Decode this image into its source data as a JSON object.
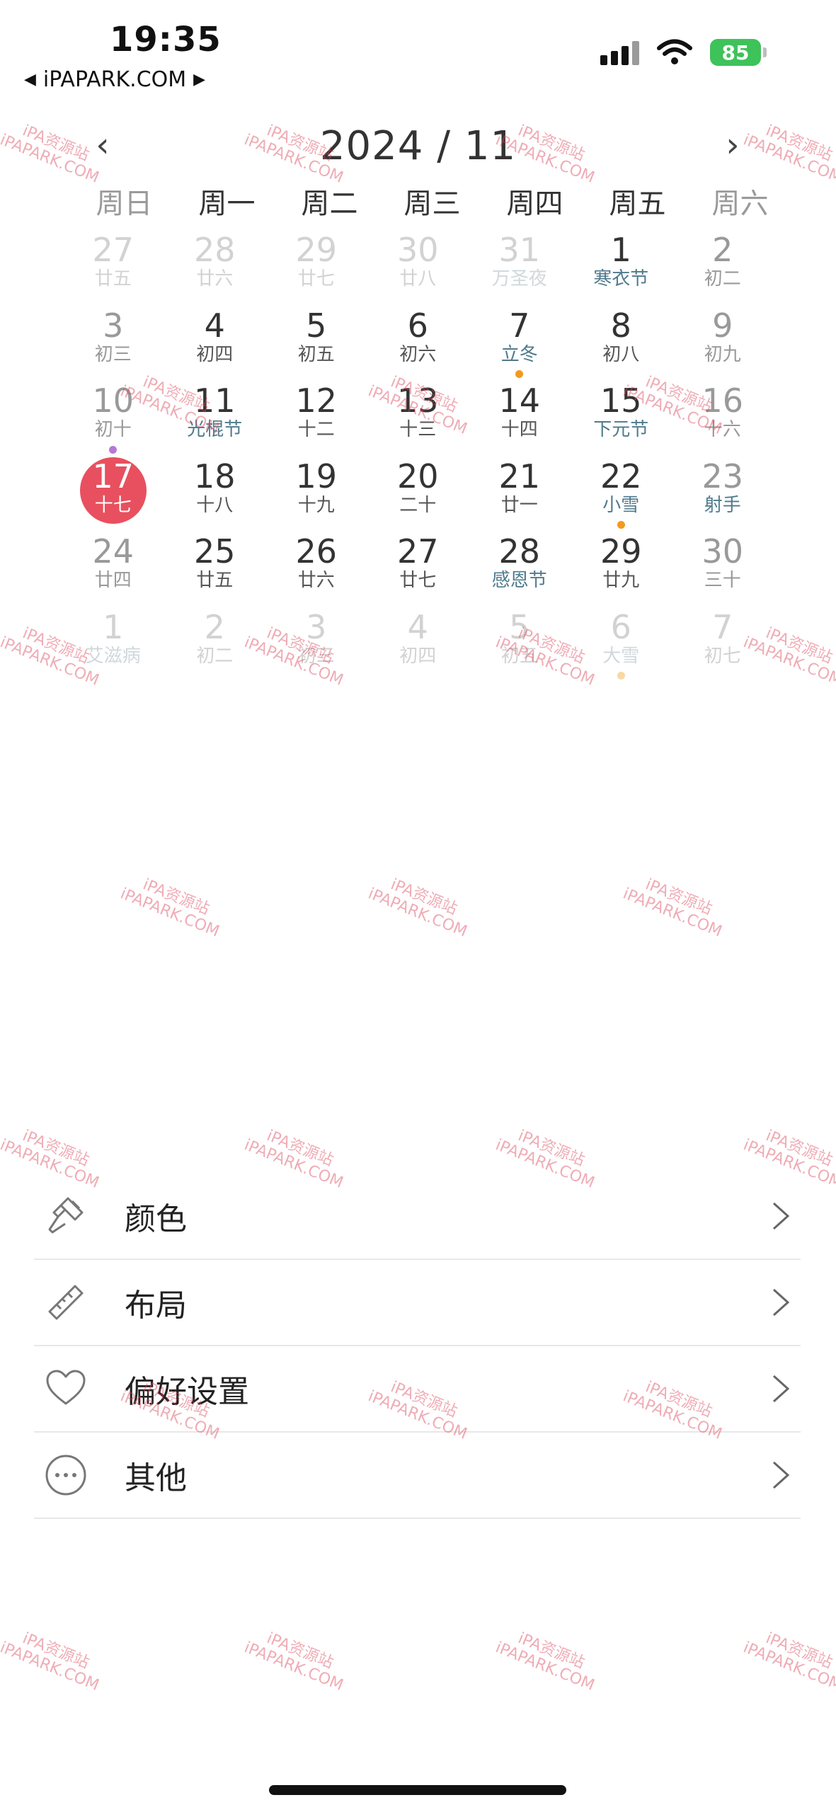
{
  "status_bar": {
    "time": "19:35",
    "back_label": "iPAPARK.COM",
    "battery": "85"
  },
  "calendar": {
    "title": "2024 / 11",
    "prev_label": "‹",
    "next_label": "›",
    "weekdays": [
      "周日",
      "周一",
      "周二",
      "周三",
      "周四",
      "周五",
      "周六"
    ],
    "days": [
      {
        "num": "27",
        "sub": "廿五",
        "state": "muted"
      },
      {
        "num": "28",
        "sub": "廿六",
        "state": "muted"
      },
      {
        "num": "29",
        "sub": "廿七",
        "state": "muted"
      },
      {
        "num": "30",
        "sub": "廿八",
        "state": "muted"
      },
      {
        "num": "31",
        "sub": "万圣夜",
        "state": "muted",
        "festival": true
      },
      {
        "num": "1",
        "sub": "寒衣节",
        "festival": true
      },
      {
        "num": "2",
        "sub": "初二",
        "weekend": true
      },
      {
        "num": "3",
        "sub": "初三",
        "weekend": true
      },
      {
        "num": "4",
        "sub": "初四"
      },
      {
        "num": "5",
        "sub": "初五"
      },
      {
        "num": "6",
        "sub": "初六"
      },
      {
        "num": "7",
        "sub": "立冬",
        "festival": true,
        "dot": "#f29a1d"
      },
      {
        "num": "8",
        "sub": "初八"
      },
      {
        "num": "9",
        "sub": "初九",
        "weekend": true
      },
      {
        "num": "10",
        "sub": "初十",
        "weekend": true,
        "dot": "#b777d6"
      },
      {
        "num": "11",
        "sub": "光棍节",
        "festival": true
      },
      {
        "num": "12",
        "sub": "十二"
      },
      {
        "num": "13",
        "sub": "十三"
      },
      {
        "num": "14",
        "sub": "十四"
      },
      {
        "num": "15",
        "sub": "下元节",
        "festival": true
      },
      {
        "num": "16",
        "sub": "十六",
        "weekend": true
      },
      {
        "num": "17",
        "sub": "十七",
        "today": true
      },
      {
        "num": "18",
        "sub": "十八"
      },
      {
        "num": "19",
        "sub": "十九"
      },
      {
        "num": "20",
        "sub": "二十"
      },
      {
        "num": "21",
        "sub": "廿一"
      },
      {
        "num": "22",
        "sub": "小雪",
        "festival": true,
        "dot": "#f29a1d"
      },
      {
        "num": "23",
        "sub": "射手",
        "weekend": true,
        "festival": true
      },
      {
        "num": "24",
        "sub": "廿四",
        "weekend": true
      },
      {
        "num": "25",
        "sub": "廿五"
      },
      {
        "num": "26",
        "sub": "廿六"
      },
      {
        "num": "27",
        "sub": "廿七"
      },
      {
        "num": "28",
        "sub": "感恩节",
        "festival": true
      },
      {
        "num": "29",
        "sub": "廿九"
      },
      {
        "num": "30",
        "sub": "三十",
        "weekend": true
      },
      {
        "num": "1",
        "sub": "艾滋病",
        "state": "muted",
        "festival": true
      },
      {
        "num": "2",
        "sub": "初二",
        "state": "muted"
      },
      {
        "num": "3",
        "sub": "初三",
        "state": "muted"
      },
      {
        "num": "4",
        "sub": "初四",
        "state": "muted"
      },
      {
        "num": "5",
        "sub": "初五",
        "state": "muted"
      },
      {
        "num": "6",
        "sub": "大雪",
        "state": "muted",
        "festival": true,
        "dot": "#f7d9a3"
      },
      {
        "num": "7",
        "sub": "初七",
        "state": "muted"
      }
    ]
  },
  "menu": {
    "items": [
      {
        "label": "颜色",
        "icon": "paint-brush-icon"
      },
      {
        "label": "布局",
        "icon": "ruler-icon"
      },
      {
        "label": "偏好设置",
        "icon": "heart-icon"
      },
      {
        "label": "其他",
        "icon": "more-icon"
      }
    ]
  },
  "watermark": {
    "line1": "iPA资源站",
    "line2": "iPAPARK.COM"
  }
}
